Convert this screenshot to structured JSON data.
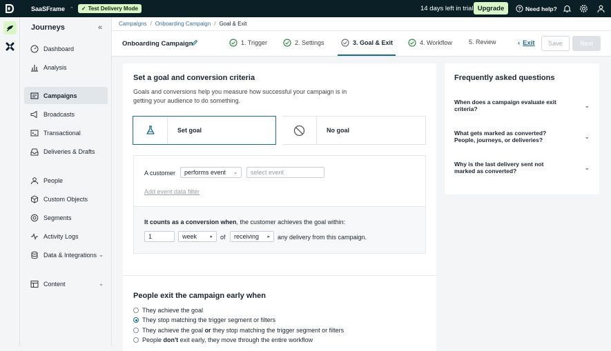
{
  "topbar": {
    "workspace": "SaaSFrame",
    "mode_badge": "Test Delivery Mode",
    "trial_text": "14 days left in trial",
    "upgrade_label": "Upgrade",
    "help_label": "Need help?"
  },
  "sidebar": {
    "title": "Journeys",
    "items": [
      {
        "label": "Dashboard",
        "icon": "gauge-icon"
      },
      {
        "label": "Analysis",
        "icon": "bar-chart-icon"
      },
      {
        "label": "Campaigns",
        "icon": "campaign-icon",
        "active": true
      },
      {
        "label": "Broadcasts",
        "icon": "megaphone-icon"
      },
      {
        "label": "Transactional",
        "icon": "terminal-icon"
      },
      {
        "label": "Deliveries & Drafts",
        "icon": "inbox-icon"
      },
      {
        "label": "People",
        "icon": "person-icon"
      },
      {
        "label": "Custom Objects",
        "icon": "cube-icon"
      },
      {
        "label": "Segments",
        "icon": "segments-icon"
      },
      {
        "label": "Activity Logs",
        "icon": "pulse-icon"
      },
      {
        "label": "Data & Integrations",
        "icon": "database-icon",
        "dropdown": true
      },
      {
        "label": "Content",
        "icon": "layout-icon",
        "dropdown": true
      }
    ]
  },
  "breadcrumb": [
    "Campaigns",
    "Onboarding Campaign",
    "Goal & Exit"
  ],
  "stepbar": {
    "campaign_name": "Onboarding Campaign",
    "steps": [
      "1. Trigger",
      "2. Settings",
      "3. Goal & Exit",
      "4. Workflow",
      "5. Review"
    ],
    "exit_label": "Exit",
    "save_label": "Save",
    "next_label": "Next"
  },
  "goal": {
    "title": "Set a goal and conversion criteria",
    "description": "Goals and conversions help you measure how successful your campaign is in getting your audience to do something.",
    "set_goal_label": "Set goal",
    "no_goal_label": "No goal",
    "customer_label": "A customer",
    "event_type": "performs event",
    "event_placeholder": "select event",
    "filter_link": "Add event data filter",
    "conversion_bold": "It counts as a conversion when",
    "conversion_rest": ", the customer achieves the goal within:",
    "within_value": "1",
    "within_unit": "week",
    "of_label": "of",
    "receiving": "receiving",
    "delivery_text": "any delivery from this campaign."
  },
  "exit": {
    "title": "People exit the campaign early when",
    "opt1": "They achieve the goal",
    "opt2": "They stop matching the trigger segment or filters",
    "opt3_a": "They achieve the goal ",
    "opt3_or": "or",
    "opt3_b": " they stop matching the trigger segment or filters",
    "opt4_a": "People ",
    "opt4_dont": "don't",
    "opt4_b": " exit early, they move through the entire workflow"
  },
  "faq": {
    "title": "Frequently asked questions",
    "items": [
      "When does a campaign evaluate exit criteria?",
      "What gets marked as converted? People, journeys, or deliveries?",
      "Why is the last delivery sent not marked as converted?"
    ]
  }
}
